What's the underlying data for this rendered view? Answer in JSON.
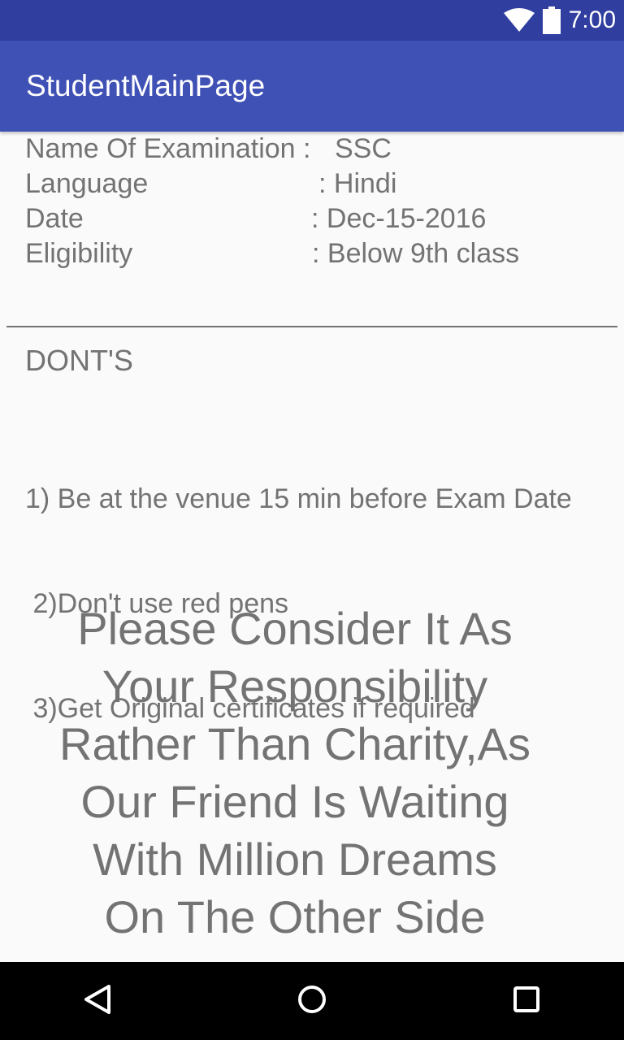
{
  "status_bar": {
    "time": "7:00",
    "icons": [
      "wifi-icon",
      "battery-icon"
    ]
  },
  "app_bar": {
    "title": "StudentMainPage",
    "color": "#3f51b5",
    "status_color": "#303f9f"
  },
  "exam_info": {
    "rows": [
      {
        "label": "Name Of Examination :",
        "value": "SSC"
      },
      {
        "label": "Language",
        "value": ": Hindi"
      },
      {
        "label": "Date",
        "value": ":  Dec-15-2016"
      },
      {
        "label": "Eligibility",
        "value": ":  Below 9th class"
      }
    ]
  },
  "donts": {
    "title": "DONT'S",
    "items": [
      "1) Be at the venue 15 min before Exam Date",
      " 2)Don't use red pens",
      " 3)Get Original certificates if required"
    ]
  },
  "message": {
    "lines": [
      "Please Consider It As",
      "Your Responsibility",
      "Rather Than Charity,As",
      "Our Friend Is Waiting",
      "With Million Dreams",
      "On The Other Side"
    ]
  },
  "nav_bar": {
    "buttons": [
      "back-icon",
      "home-icon",
      "recents-icon"
    ]
  }
}
